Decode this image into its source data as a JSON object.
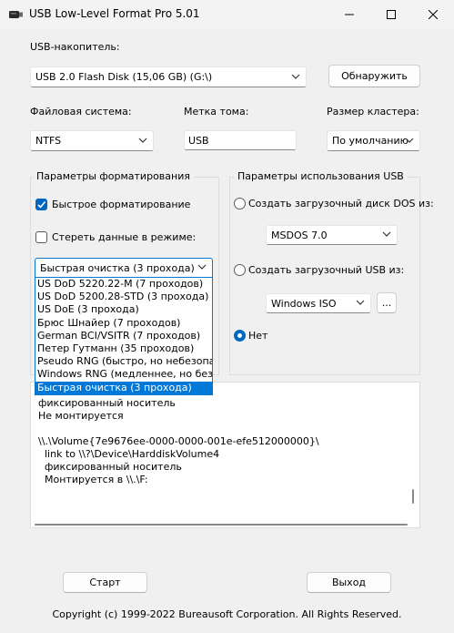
{
  "window": {
    "title": "USB Low-Level Format Pro 5.01",
    "icon": "usb-drive-icon"
  },
  "usb_drive": {
    "label": "USB-накопитель:",
    "selected": "USB 2.0 Flash Disk (15,06 GB) (G:\\)",
    "detect_button": "Обнаружить"
  },
  "filesystem": {
    "label": "Файловая система:",
    "selected": "NTFS"
  },
  "volume_label": {
    "label": "Метка тома:",
    "value": "USB"
  },
  "cluster_size": {
    "label": "Размер кластера:",
    "selected": "По умолчанию"
  },
  "format_params": {
    "title": "Параметры форматирования",
    "quick_format": {
      "label": "Быстрое форматирование",
      "checked": true
    },
    "wipe_mode": {
      "label": "Стереть данные в режиме:",
      "checked": false
    },
    "wipe_method": {
      "selected": "Быстрая очистка (3 прохода)",
      "options": [
        "US DoD 5220.22-M (7 проходов)",
        "US DoD 5200.28-STD (3 прохода)",
        "US DoE (3 прохода)",
        "Брюс Шнайер (7 проходов)",
        "German BCI/VSITR (7 проходов)",
        "Петер Гутманн (35 проходов)",
        "Pseudo RNG (быстро, но небезопасно",
        "Windows RNG (медленнее, но безопа",
        "Быстрая очистка (3 прохода)"
      ]
    }
  },
  "usb_usage": {
    "title": "Параметры использования USB",
    "dos_boot": {
      "label": "Создать загрузочный диск DOS из:",
      "selected": "MSDOS 7.0"
    },
    "usb_boot": {
      "label": "Создать загрузочный USB из:",
      "selected": "Windows ISO",
      "browse_button": "..."
    },
    "none": {
      "label": "Нет",
      "checked": true
    }
  },
  "log": {
    "lines": [
      "фиксированный носитель",
      "Не монтируется",
      "",
      "\\\\.\\Volume{7e9676ee-0000-0000-001e-efe512000000}\\",
      "  link to \\\\?\\Device\\HarddiskVolume4",
      "  фиксированный носитель",
      "  Монтируется в \\\\.\\F:"
    ]
  },
  "buttons": {
    "start": "Старт",
    "exit": "Выход"
  },
  "footer": {
    "copyright": "Copyright (c) 1999-2022 Bureausoft Corporation. All Rights Reserved."
  },
  "colors": {
    "accent": "#0067c0",
    "selection": "#0078d7",
    "background": "#f0f0f0"
  }
}
